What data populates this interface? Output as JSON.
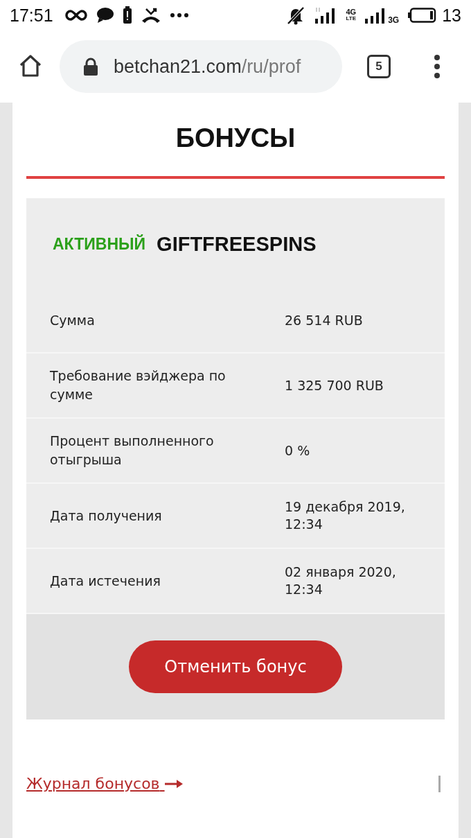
{
  "status_bar": {
    "time": "17:51",
    "battery": "13",
    "network_1": "4G",
    "network_1_sub": "LTE",
    "network_2": "3G"
  },
  "browser": {
    "url_host": "betchan21.com",
    "url_path": "/ru/prof",
    "tab_count": "5"
  },
  "page": {
    "title": "БОНУСЫ",
    "bonus": {
      "status": {
        "label": "АКТИВНЫЙ",
        "active": true
      },
      "code": "GIFTFREESPINS",
      "rows": [
        {
          "label": "Сумма",
          "value": "26 514 RUB"
        },
        {
          "label": "Требование вэйджера по сумме",
          "value": "1 325 700 RUB"
        },
        {
          "label": "Процент выполненного отыгрыша",
          "value": "0 %"
        },
        {
          "label": "Дата получения",
          "value": "19 декабря 2019, 12:34"
        },
        {
          "label": "Дата истечения",
          "value": "02 января 2020, 12:34"
        }
      ],
      "cancel_button": "Отменить бонус"
    },
    "history_link": "Журнал бонусов"
  }
}
